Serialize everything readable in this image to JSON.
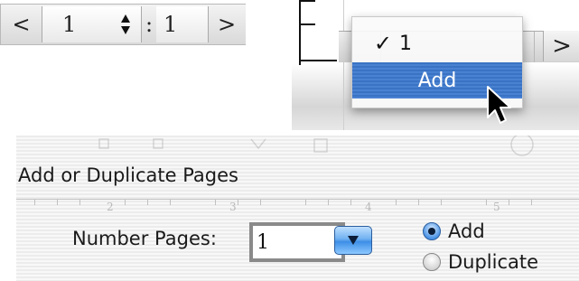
{
  "stepper": {
    "prev_label": "<",
    "current_page": "1",
    "separator": ":",
    "page_count": "1",
    "next_label": ">"
  },
  "popup_menu": {
    "check_mark": "✓",
    "items": [
      {
        "label": "1",
        "checked": true
      },
      {
        "label": "Add",
        "highlighted": true
      }
    ],
    "obscured_next_label": ">"
  },
  "add_pages_panel": {
    "title": "Add or Duplicate Pages",
    "ruler_numbers": [
      "2",
      "3",
      "4",
      "5"
    ],
    "number_pages_label": "Number Pages:",
    "number_pages_value": "1",
    "options": [
      {
        "label": "Add",
        "selected": true
      },
      {
        "label": "Duplicate",
        "selected": false
      }
    ]
  },
  "colors": {
    "highlight": "#3a73c4",
    "aqua_blue": "#4b93e6",
    "stripe": "#ececec"
  }
}
